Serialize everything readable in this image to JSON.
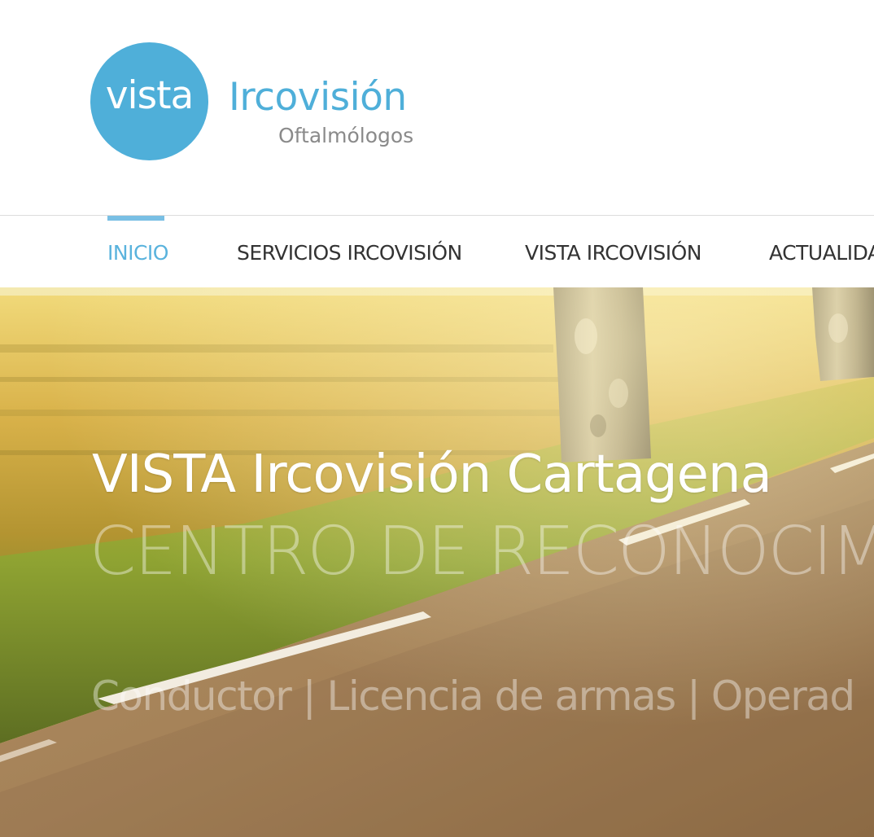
{
  "logo": {
    "circle_text": "vista",
    "brand": "Ircovisión",
    "subtitle": "Oftalmólogos",
    "colors": {
      "accent": "#4fafd9",
      "subtitle": "#8a8a8a"
    }
  },
  "nav": {
    "items": [
      {
        "label": "INICIO",
        "active": true
      },
      {
        "label": "SERVICIOS IRCOVISIÓN",
        "active": false
      },
      {
        "label": "VISTA IRCOVISIÓN",
        "active": false
      },
      {
        "label": "ACTUALIDA",
        "active": false
      }
    ],
    "colors": {
      "active": "#5ab3dd",
      "default": "#333333"
    }
  },
  "hero": {
    "title": "VISTA Ircovisión Cartagena",
    "subtitle": "CENTRO DE RECONOCIMI",
    "tagline": "Conductor | Licencia de armas | Operad"
  }
}
